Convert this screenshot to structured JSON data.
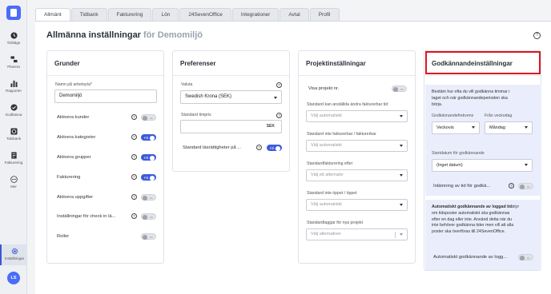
{
  "sidebar": {
    "items": [
      {
        "label": "Tidsläge",
        "icon": "clock-icon"
      },
      {
        "label": "Planera",
        "icon": "planning-icon"
      },
      {
        "label": "Rapporter",
        "icon": "bar-chart-icon"
      },
      {
        "label": "Godkänna",
        "icon": "check-circle-icon"
      },
      {
        "label": "Tidsbank",
        "icon": "time-bank-icon"
      },
      {
        "label": "Fakturering",
        "icon": "invoice-icon"
      },
      {
        "label": "Mer",
        "icon": "more-icon"
      },
      {
        "label": "Inställningar",
        "icon": "gear-icon"
      }
    ],
    "avatar_initials": "LS"
  },
  "tabs": [
    "Allmänt",
    "Tidbank",
    "Fakturering",
    "Lön",
    "24SevenOffice",
    "Integrationer",
    "Avtal",
    "Profil"
  ],
  "page": {
    "title": "Allmänna inställningar",
    "org": "för Demomiljö"
  },
  "grunder": {
    "title": "Grunder",
    "workplace_label": "Namn på arbetsyta*",
    "workplace_value": "Demomiljö",
    "rows": [
      {
        "label": "Aktivera kunder",
        "state": "av"
      },
      {
        "label": "Aktivera kategorier",
        "state": "PÅ"
      },
      {
        "label": "Aktivera grupper",
        "state": "PÅ"
      },
      {
        "label": "Fakturering",
        "state": "PÅ"
      },
      {
        "label": "Aktivera uppgifter",
        "state": "av"
      },
      {
        "label": "Inställningar för check in lä...",
        "state": "av"
      },
      {
        "label": "Roller",
        "state": "av"
      }
    ]
  },
  "preferenser": {
    "title": "Preferenser",
    "currency_label": "Valuta",
    "currency_value": "Swedish Krona (SEK)",
    "rate_label": "Standard timpris",
    "rate_unit": "SEK",
    "perm_label": "Standard läsrättigheter på ...",
    "perm_state": "PÅ"
  },
  "projekt": {
    "title": "Projektinställningar",
    "show_nr_label": "Visa projekt nr.",
    "show_nr_state": "av",
    "fields": [
      {
        "label": "Standard kan anställda ändra fakturerbar tid",
        "placeholder": "Välj automatiskt"
      },
      {
        "label": "Standard inte fakturerbar / fakturerbar",
        "placeholder": "Välj automatiskt"
      },
      {
        "label": "Standardfakturering efter",
        "placeholder": "Välj ett alternativ"
      },
      {
        "label": "Standard inte öppet / öppet",
        "placeholder": "Välj automatiskt"
      },
      {
        "label": "Standardtaggar för nya projekt",
        "placeholder": "Välj alternativer"
      }
    ]
  },
  "godkannande": {
    "title": "Godkännandeinställningar",
    "description": [
      "Bestäm hur ofta du vill godkänna timmar i",
      "taget och när godkännandeperioden ska",
      "börja."
    ],
    "freq_label": "Godkännandefrekvens",
    "freq_value": "Veckovis",
    "from_label": "Från veckodag",
    "from_value": "Måndag",
    "start_label": "Startdatum för godkännande",
    "start_value": "(Inget datum)",
    "submit_label": "Inlämning av tid för godkä...",
    "submit_state": "av",
    "auto_title": "Automatiskt godkännande av loggad tid",
    "auto_lines": [
      "styr",
      "om tidsposter automatiskt ska godkännas",
      "efter en dag eller inte. Använd detta när du",
      "inte behöver godkänna tider men vill att alla",
      "poster ska överföras till 24SevenOffice."
    ],
    "auto_toggle_label": "Automatiskt godkännande av logg...",
    "auto_toggle_state": "av"
  }
}
